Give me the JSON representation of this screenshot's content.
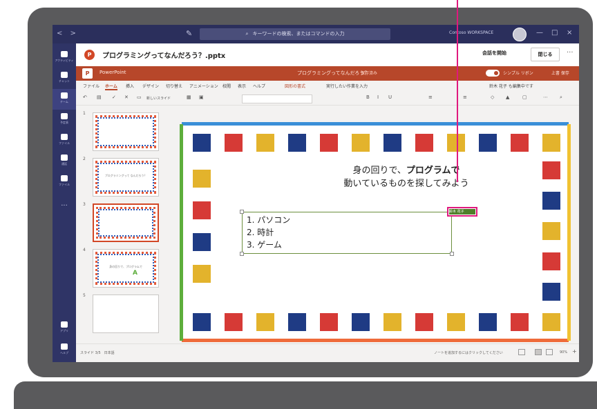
{
  "titlebar": {
    "nav": "< >",
    "search_placeholder": "キーワードの検索、またはコマンドの入力",
    "org": "Contoso WORKSPACE",
    "window_controls": [
      "—",
      "□",
      "×"
    ]
  },
  "rail": {
    "items": [
      {
        "label": "アクティビティ",
        "icon": "bell-icon"
      },
      {
        "label": "チャット",
        "icon": "chat-icon"
      },
      {
        "label": "チーム",
        "icon": "team-icon",
        "active": true
      },
      {
        "label": "予定表",
        "icon": "calendar-icon"
      },
      {
        "label": "ファイル",
        "icon": "files-icon"
      },
      {
        "label": "通話",
        "icon": "phone-icon"
      },
      {
        "label": "ファイル",
        "icon": "file-icon"
      }
    ],
    "more": "···",
    "apps_label": "アプリ",
    "help_label": "ヘルプ"
  },
  "doc_header": {
    "icon_letter": "P",
    "title": "プログラミングってなんだろう？.pptx",
    "start_meeting": "会話を開始",
    "close": "閉じる",
    "more": "···"
  },
  "ppt_bar": {
    "app_name": "PowerPoint",
    "doc_name": "プログラミングってなんだろう？",
    "saved": "保存済み",
    "simple_ribbon": "シンプル リボン",
    "editor": "上書 保存"
  },
  "ribbon": {
    "tabs": [
      "ファイル",
      "ホーム",
      "挿入",
      "デザイン",
      "切り替え",
      "アニメーション",
      "校閲",
      "表示",
      "ヘルプ"
    ],
    "active_tab": "ホーム",
    "search": "実行したい作業を入力",
    "shape_format": "図形の書式",
    "user_edit": "鈴木 花子 も編集中です",
    "new_slide": "新しいスライド"
  },
  "thumbnails": [
    {
      "num": "1",
      "text": ""
    },
    {
      "num": "2",
      "text": "プログラミングって なんだろう？"
    },
    {
      "num": "3",
      "text": "",
      "selected": true
    },
    {
      "num": "4",
      "text": "身の回りで、プログラムで"
    },
    {
      "num": "5",
      "text": "",
      "blank": true
    }
  ],
  "slide": {
    "title_line1_pre": "身の回りで、",
    "title_line1_bold": "プログラムで",
    "title_line2": "動いているものを探してみよう",
    "list": [
      "1. パソコン",
      "2. 時計",
      "3. ゲーム"
    ],
    "colors": {
      "navy": "#1f3b84",
      "red": "#d63a36",
      "yellow": "#e3b32c",
      "blue_bar": "#3a8fd8",
      "orange_bar": "#ef6b3a",
      "green_bar": "#5dae3c",
      "gold_bar": "#f1c232"
    },
    "tag_label": "鈴木 花子"
  },
  "status": {
    "slide_info": "スライド 3/5　日本語",
    "notes": "ノートを追加するにはクリックしてください",
    "zoom": "90%",
    "view_label": "ノート"
  }
}
